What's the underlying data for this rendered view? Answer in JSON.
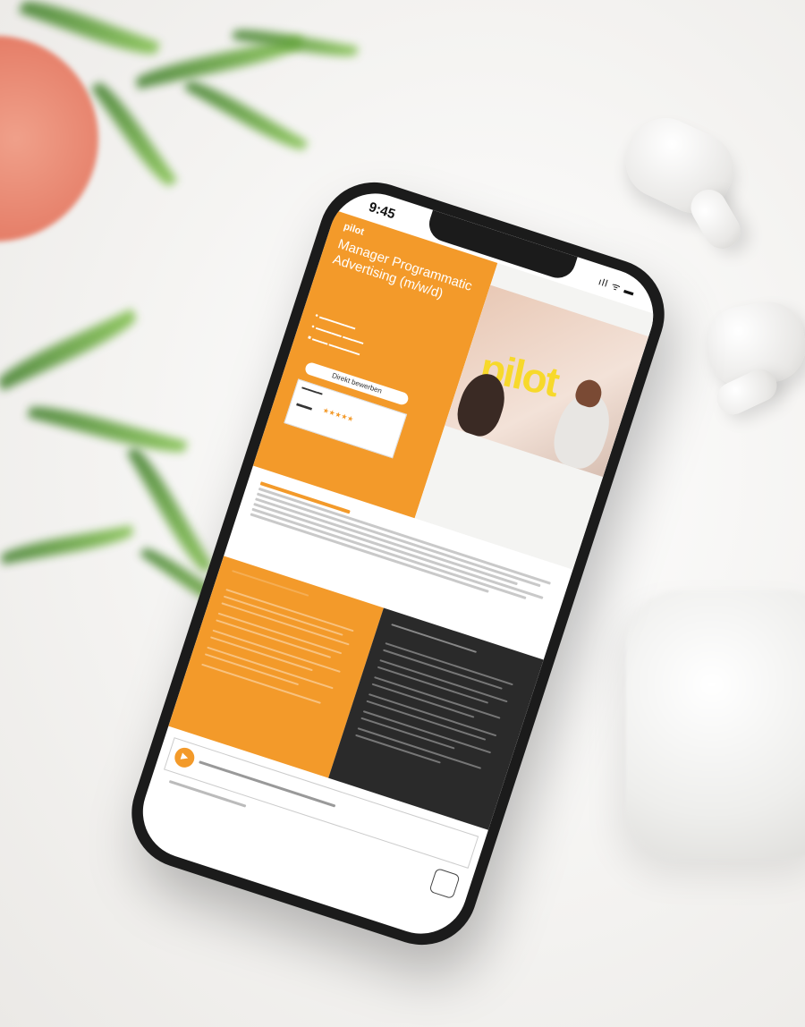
{
  "phone": {
    "time": "9:45",
    "signal": "ıll ᯤ ▬"
  },
  "hero": {
    "logo": "pilot",
    "title": "Manager Programmatic Advertising (m/w/d)",
    "photo_sign": "pilot",
    "apply_button": "Direkt bewerben"
  },
  "colors": {
    "accent": "#f39a2a",
    "dark": "#2a2a2a"
  },
  "icons": [
    "play-icon",
    "chat-icon",
    "location-icon",
    "clock-icon"
  ]
}
